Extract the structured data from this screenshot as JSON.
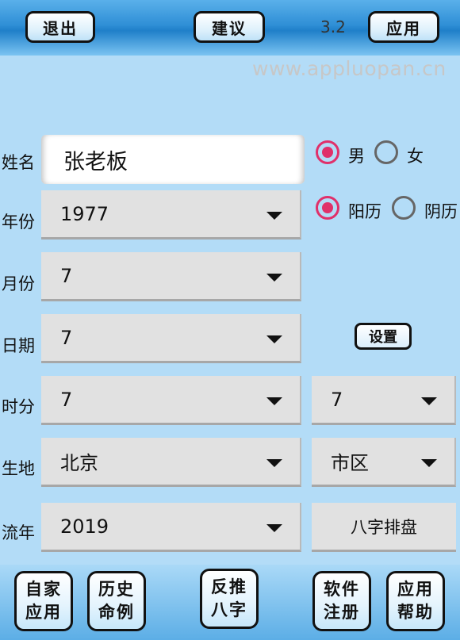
{
  "header": {
    "exit_label": "退出",
    "suggest_label": "建议",
    "version": "3.2",
    "apply_label": "应用",
    "watermark": "www.appluopan.cn"
  },
  "form": {
    "name_label": "姓名",
    "name_value": "张老板",
    "year_label": "年份",
    "year_value": "1977",
    "month_label": "月份",
    "month_value": "7",
    "day_label": "日期",
    "day_value": "7",
    "hour_label": "时分",
    "hour_value": "7",
    "minute_value": "7",
    "birthplace_label": "生地",
    "province_value": "北京",
    "district_value": "市区",
    "flow_year_label": "流年",
    "flow_year_value": "2019"
  },
  "gender": {
    "male": "男",
    "female": "女",
    "selected": "male"
  },
  "calendar": {
    "solar": "阳历",
    "lunar": "阴历",
    "selected": "solar"
  },
  "settings_label": "设置",
  "bazi_label": "八字排盘",
  "bottom_nav": [
    {
      "line1": "自家",
      "line2": "应用"
    },
    {
      "line1": "历史",
      "line2": "命例"
    },
    {
      "line1": "反推",
      "line2": "八字"
    },
    {
      "line1": "软件",
      "line2": "注册"
    },
    {
      "line1": "应用",
      "line2": "帮助"
    }
  ],
  "colors": {
    "accent_radio": "#e0306a",
    "header_blue": "#2f8fd6",
    "background": "#b3dcf7"
  }
}
